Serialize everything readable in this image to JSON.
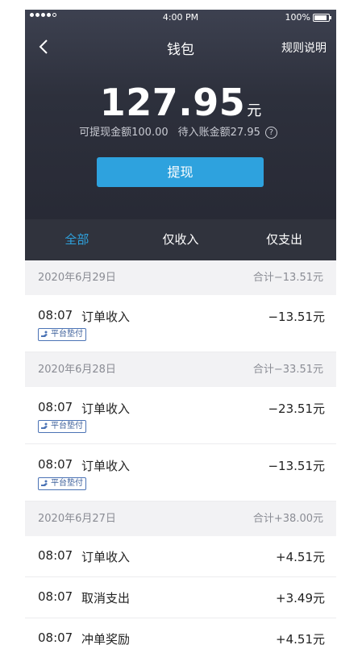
{
  "status_bar": {
    "time": "4:00 PM",
    "battery": "100%"
  },
  "nav": {
    "title": "钱包",
    "rules": "规则说明"
  },
  "balance": {
    "amount": "127.95",
    "unit": "元",
    "withdrawable": "可提现金额100.00",
    "pending": "待入账金额27.95",
    "help_glyph": "?"
  },
  "withdraw_button": "提现",
  "tabs": [
    {
      "label": "全部",
      "active": true
    },
    {
      "label": "仅收入",
      "active": false
    },
    {
      "label": "仅支出",
      "active": false
    }
  ],
  "groups": [
    {
      "date": "2020年6月29日",
      "total": "合计−13.51元",
      "items": [
        {
          "time": "08:07",
          "type": "订单收入",
          "amount": "−13.51元",
          "tag": "平台垫付"
        }
      ]
    },
    {
      "date": "2020年6月28日",
      "total": "合计−33.51元",
      "items": [
        {
          "time": "08:07",
          "type": "订单收入",
          "amount": "−23.51元",
          "tag": "平台垫付"
        },
        {
          "time": "08:07",
          "type": "订单收入",
          "amount": "−13.51元",
          "tag": "平台垫付"
        }
      ]
    },
    {
      "date": "2020年6月27日",
      "total": "合计+38.00元",
      "items": [
        {
          "time": "08:07",
          "type": "订单收入",
          "amount": "+4.51元"
        },
        {
          "time": "08:07",
          "type": "取消支出",
          "amount": "+3.49元"
        },
        {
          "time": "08:07",
          "type": "冲单奖励",
          "amount": "+4.51元"
        }
      ]
    }
  ],
  "colors": {
    "accent": "#2ea2de",
    "header_bg": "#2d303c",
    "tag_border": "#4b73b5"
  }
}
